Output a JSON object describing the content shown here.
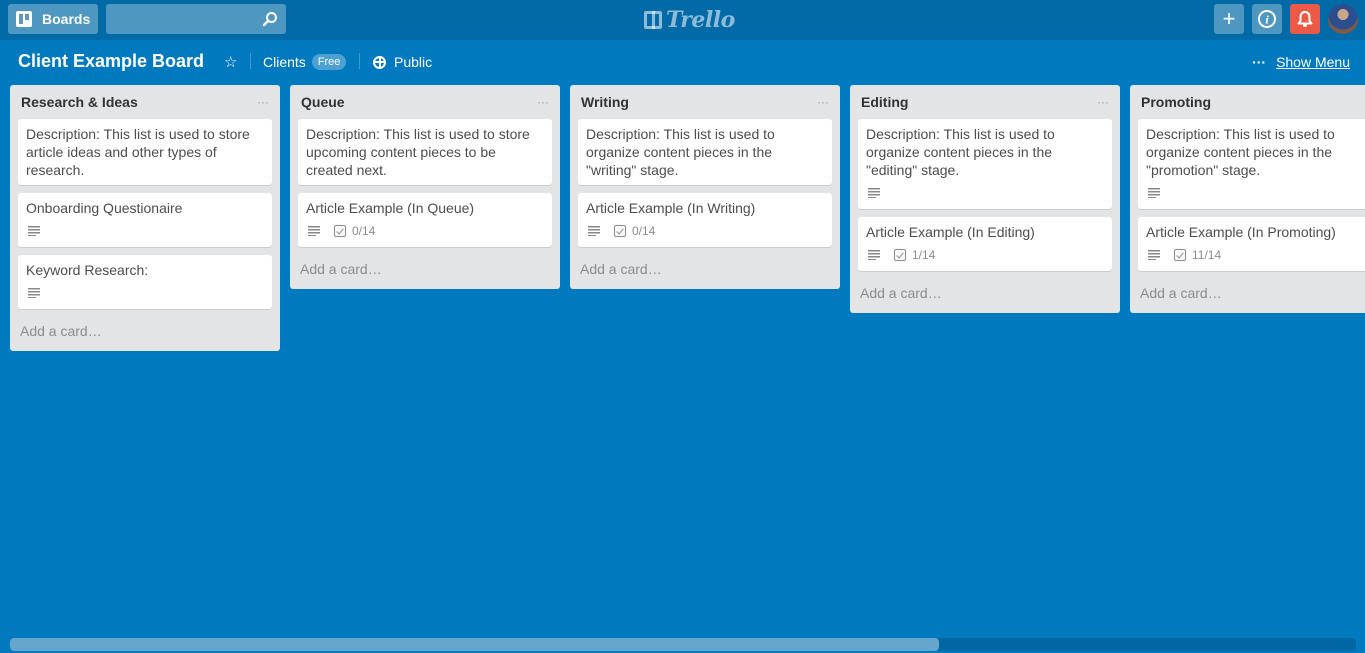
{
  "header": {
    "boards_label": "Boards",
    "search_placeholder": "",
    "logo_text": "Trello",
    "add_label": "+",
    "info_label": "i",
    "notification_color": "#eb5a46"
  },
  "board": {
    "title": "Client Example Board",
    "team": "Clients",
    "team_badge": "Free",
    "visibility": "Public",
    "show_menu_dots": "···",
    "show_menu": "Show Menu",
    "background_color": "#0079bf"
  },
  "lists": [
    {
      "title": "Research & Ideas",
      "menu": "···",
      "cards": [
        {
          "text": "Description: This list is used to store article ideas and other types of research.",
          "has_description": false,
          "checklist": null
        },
        {
          "text": "Onboarding Questionaire",
          "has_description": true,
          "checklist": null
        },
        {
          "text": "Keyword Research:",
          "has_description": true,
          "checklist": null
        }
      ],
      "add_card": "Add a card…"
    },
    {
      "title": "Queue",
      "menu": "···",
      "cards": [
        {
          "text": "Description: This list is used to store upcoming content pieces to be created next.",
          "has_description": false,
          "checklist": null
        },
        {
          "text": "Article Example (In Queue)",
          "has_description": true,
          "checklist": "0/14"
        }
      ],
      "add_card": "Add a card…"
    },
    {
      "title": "Writing",
      "menu": "···",
      "cards": [
        {
          "text": "Description: This list is used to organize content pieces in the \"writing\" stage.",
          "has_description": false,
          "checklist": null
        },
        {
          "text": "Article Example (In Writing)",
          "has_description": true,
          "checklist": "0/14"
        }
      ],
      "add_card": "Add a card…"
    },
    {
      "title": "Editing",
      "menu": "···",
      "cards": [
        {
          "text": "Description: This list is used to organize content pieces in the \"editing\" stage.",
          "has_description": true,
          "checklist": null
        },
        {
          "text": "Article Example (In Editing)",
          "has_description": true,
          "checklist": "1/14"
        }
      ],
      "add_card": "Add a card…"
    },
    {
      "title": "Promoting",
      "menu": "···",
      "cards": [
        {
          "text": "Description: This list is used to organize content pieces in the \"promotion\" stage.",
          "has_description": true,
          "checklist": null
        },
        {
          "text": "Article Example (In Promoting)",
          "has_description": true,
          "checklist": "11/14"
        }
      ],
      "add_card": "Add a card…"
    }
  ],
  "scrollbar": {
    "visible_fraction": 0.69,
    "position_fraction": 0.0
  }
}
